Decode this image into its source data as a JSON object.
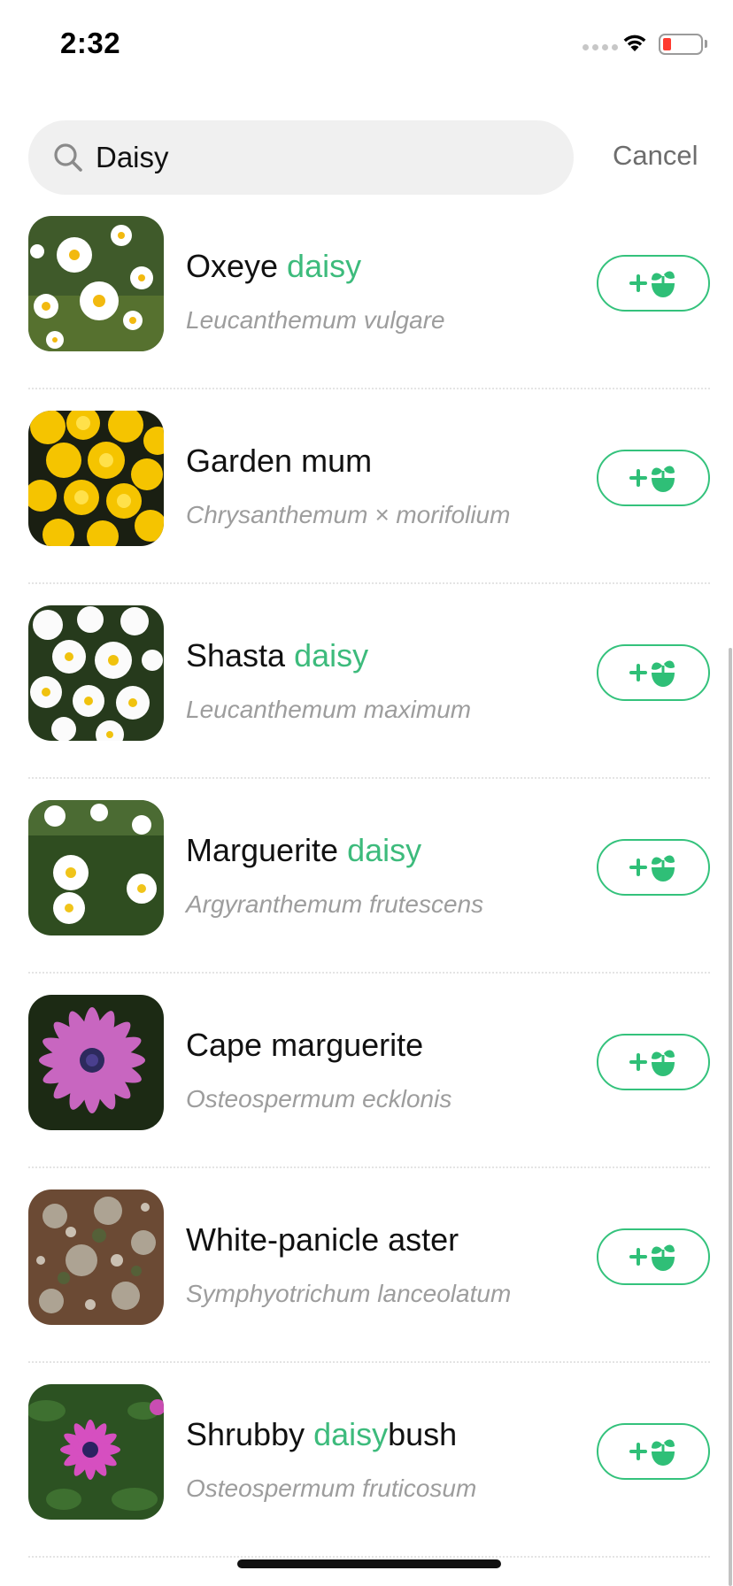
{
  "status_bar": {
    "time": "2:32",
    "battery_color": "#ff3b30"
  },
  "search": {
    "value": "Daisy",
    "icon": "search-icon",
    "cancel_label": "Cancel"
  },
  "colors": {
    "accent": "#3dbb7c",
    "secondary_text": "#9d9d9d"
  },
  "results": [
    {
      "name_parts": [
        {
          "text": "Oxeye ",
          "hl": false
        },
        {
          "text": "daisy",
          "hl": true
        }
      ],
      "scientific": "Leucanthemum vulgare",
      "thumb": "oxeye-daisy-photo"
    },
    {
      "name_parts": [
        {
          "text": "Garden mum",
          "hl": false
        }
      ],
      "scientific": "Chrysanthemum × morifolium",
      "thumb": "garden-mum-photo"
    },
    {
      "name_parts": [
        {
          "text": "Shasta ",
          "hl": false
        },
        {
          "text": "daisy",
          "hl": true
        }
      ],
      "scientific": "Leucanthemum maximum",
      "thumb": "shasta-daisy-photo"
    },
    {
      "name_parts": [
        {
          "text": "Marguerite ",
          "hl": false
        },
        {
          "text": "daisy",
          "hl": true
        }
      ],
      "scientific": "Argyranthemum frutescens",
      "thumb": "marguerite-daisy-photo"
    },
    {
      "name_parts": [
        {
          "text": "Cape marguerite",
          "hl": false
        }
      ],
      "scientific": "Osteospermum ecklonis",
      "thumb": "cape-marguerite-photo"
    },
    {
      "name_parts": [
        {
          "text": "White-panicle aster",
          "hl": false
        }
      ],
      "scientific": "Symphyotrichum lanceolatum",
      "thumb": "white-panicle-aster-photo"
    },
    {
      "name_parts": [
        {
          "text": "Shrubby ",
          "hl": false
        },
        {
          "text": "daisy",
          "hl": true
        },
        {
          "text": "bush",
          "hl": false
        }
      ],
      "scientific": "Osteospermum fruticosum",
      "thumb": "shrubby-daisybush-photo"
    }
  ],
  "add_button_icon": "add-plant-icon"
}
